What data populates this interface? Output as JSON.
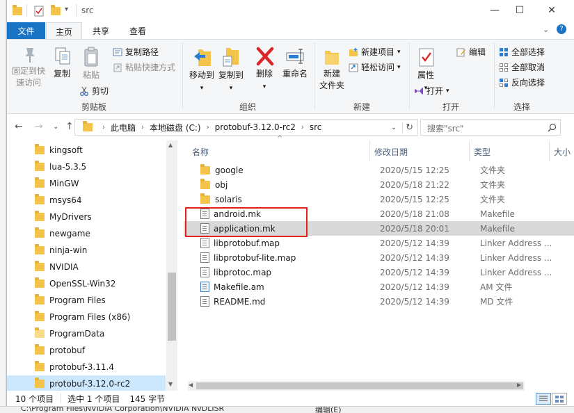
{
  "window": {
    "title": "src",
    "controls": {
      "minimize": "—",
      "maximize": "☐",
      "close": "✕"
    }
  },
  "ribbon": {
    "tabs": [
      "文件",
      "主页",
      "共享",
      "查看"
    ],
    "clipboard": {
      "group_label": "剪贴板",
      "pin_label": "固定到快\n速访问",
      "copy_label": "复制",
      "paste_label": "粘贴",
      "copy_path": "复制路径",
      "paste_shortcut": "粘贴快捷方式",
      "cut": "剪切"
    },
    "organize": {
      "group_label": "组织",
      "move_to": "移动到",
      "copy_to": "复制到",
      "delete": "删除",
      "rename": "重命名"
    },
    "new": {
      "group_label": "新建",
      "new_folder": "新建\n文件夹",
      "new_item": "新建项目",
      "easy_access": "轻松访问"
    },
    "open": {
      "group_label": "打开",
      "properties": "属性",
      "open": "打开",
      "edit": "编辑"
    },
    "select": {
      "group_label": "选择",
      "select_all": "全部选择",
      "select_none": "全部取消",
      "invert": "反向选择"
    }
  },
  "address": {
    "crumbs": [
      "此电脑",
      "本地磁盘 (C:)",
      "protobuf-3.12.0-rc2",
      "src"
    ],
    "search_placeholder": "搜索\"src\""
  },
  "nav": {
    "items": [
      "kingsoft",
      "lua-5.3.5",
      "MinGW",
      "msys64",
      "MyDrivers",
      "newgame",
      "ninja-win",
      "NVIDIA",
      "OpenSSL-Win32",
      "Program Files",
      "Program Files (x86)",
      "ProgramData",
      "protobuf",
      "protobuf-3.11.4",
      "protobuf-3.12.0-rc2"
    ],
    "selected_index": 14
  },
  "files": {
    "columns": {
      "name": "名称",
      "date": "修改日期",
      "type": "类型",
      "size": "大小"
    },
    "rows": [
      {
        "name": "google",
        "date": "2020/5/15 12:25",
        "type": "文件夹",
        "kind": "folder"
      },
      {
        "name": "obj",
        "date": "2020/5/18 21:22",
        "type": "文件夹",
        "kind": "folder"
      },
      {
        "name": "solaris",
        "date": "2020/5/15 12:25",
        "type": "文件夹",
        "kind": "folder"
      },
      {
        "name": "android.mk",
        "date": "2020/5/18 21:08",
        "type": "Makefile",
        "kind": "mk"
      },
      {
        "name": "application.mk",
        "date": "2020/5/18 20:01",
        "type": "Makefile",
        "kind": "mk"
      },
      {
        "name": "libprotobuf.map",
        "date": "2020/5/12 14:39",
        "type": "Linker Address ...",
        "kind": "file"
      },
      {
        "name": "libprotobuf-lite.map",
        "date": "2020/5/12 14:39",
        "type": "Linker Address ...",
        "kind": "file"
      },
      {
        "name": "libprotoc.map",
        "date": "2020/5/12 14:39",
        "type": "Linker Address ...",
        "kind": "file"
      },
      {
        "name": "Makefile.am",
        "date": "2020/5/12 14:39",
        "type": "AM 文件",
        "kind": "am"
      },
      {
        "name": "README.md",
        "date": "2020/5/12 14:39",
        "type": "MD 文件",
        "kind": "file"
      }
    ],
    "highlighted_index": 4
  },
  "status": {
    "item_count": "10 个项目",
    "selection": "选中 1 个项目",
    "size": "145 字节"
  },
  "background": {
    "bottom_text": "C:\\Program Files\\NVIDIA Corporation\\NVIDIA NvDLISR",
    "bottom_text2": "编辑(E)"
  },
  "colors": {
    "accent": "#1a74c6",
    "selection": "#cce8ff",
    "highlight_row": "#d9d9d9",
    "annotation": "#e3201b",
    "folder": "#f3c34c"
  }
}
